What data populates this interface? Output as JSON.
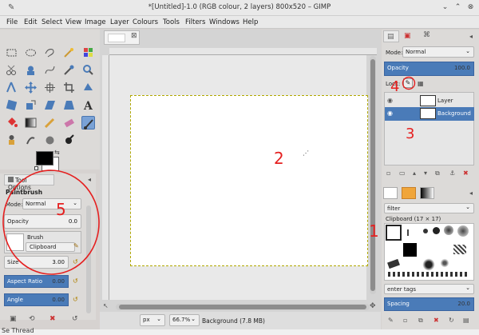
{
  "window": {
    "title": "*[Untitled]-1.0 (RGB colour, 2 layers) 800x520 – GIMP",
    "minimize_icon": "chevron-down-icon",
    "maximize_icon": "chevron-up-icon",
    "close_icon": "close-icon"
  },
  "menu": [
    "File",
    "Edit",
    "Select",
    "View",
    "Image",
    "Layer",
    "Colours",
    "Tools",
    "Filters",
    "Windows",
    "Help"
  ],
  "tool_options": {
    "tab_label": "Tool Options",
    "tool_name": "Paintbrush",
    "mode_label": "Mode:",
    "mode_value": "Normal",
    "opacity_label": "Opacity",
    "opacity_value": "0.0",
    "brush_label": "Brush",
    "brush_value": "Clipboard",
    "size_label": "Size",
    "size_value": "3.00",
    "aspect_label": "Aspect Ratio",
    "aspect_value": "0.00",
    "angle_label": "Angle",
    "angle_value": "0.00"
  },
  "status": {
    "unit": "px",
    "zoom": "66.7%",
    "layer_info": "Background (7.8 MB)"
  },
  "layers": {
    "mode_label": "Mode:",
    "mode_value": "Normal",
    "opacity_label": "Opacity",
    "opacity_value": "100.0",
    "lock_label": "Lock:",
    "items": [
      {
        "name": "Layer",
        "selected": false
      },
      {
        "name": "Background",
        "selected": true
      }
    ]
  },
  "brushes": {
    "filter_placeholder": "filter",
    "current": "Clipboard (17 × 17)",
    "tags_placeholder": "enter tags",
    "spacing_label": "Spacing",
    "spacing_value": "20.0"
  },
  "annotations": [
    "1",
    "2",
    "3",
    "4",
    "5"
  ],
  "bottom_text": "Se Thread",
  "colors": {
    "annotation": "#e52020",
    "selection_blue": "#4a7bb8",
    "marching_ants": "#b0a800"
  }
}
